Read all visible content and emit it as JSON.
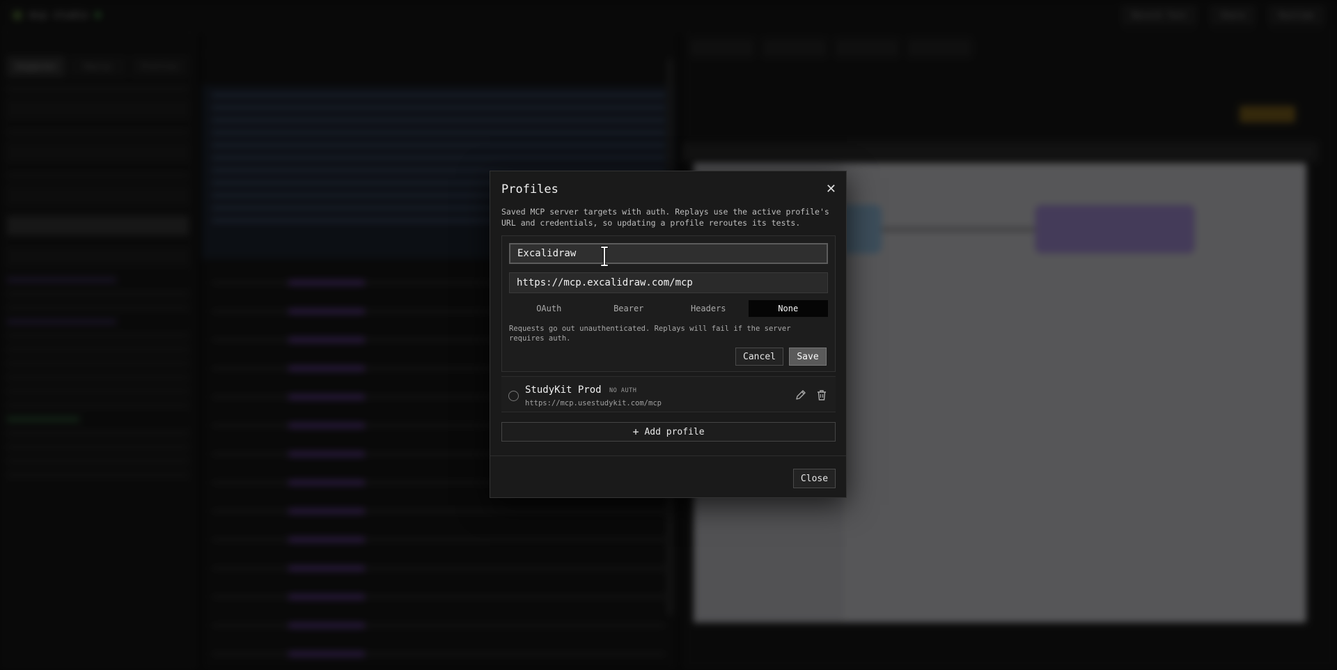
{
  "background": {
    "app_title": "mcp studio",
    "topbar_buttons": [
      "Record Test",
      "Share",
      "Runtime"
    ],
    "left_tabs": [
      "Inspector",
      "Replay",
      "Profiles"
    ]
  },
  "modal": {
    "title": "Profiles",
    "close_glyph": "✕",
    "description": "Saved MCP server targets with auth. Replays use the active profile's URL and credentials, so updating a profile reroutes its tests.",
    "form": {
      "name_value": "Excalidraw",
      "url_value": "https://mcp.excalidraw.com/mcp",
      "auth_options": [
        "OAuth",
        "Bearer",
        "Headers",
        "None"
      ],
      "auth_selected": "None",
      "auth_note": "Requests go out unauthenticated. Replays will fail if the server requires auth.",
      "cancel_label": "Cancel",
      "save_label": "Save"
    },
    "profiles": [
      {
        "name": "StudyKit Prod",
        "badge": "NO AUTH",
        "url": "https://mcp.usestudykit.com/mcp"
      }
    ],
    "add_profile_label": "Add profile",
    "add_icon": "plus-icon",
    "close_label": "Close"
  },
  "colors": {
    "modal_bg": "#1a1a1a",
    "segment_active": "#050505",
    "save_bg": "#5a5a5a"
  }
}
